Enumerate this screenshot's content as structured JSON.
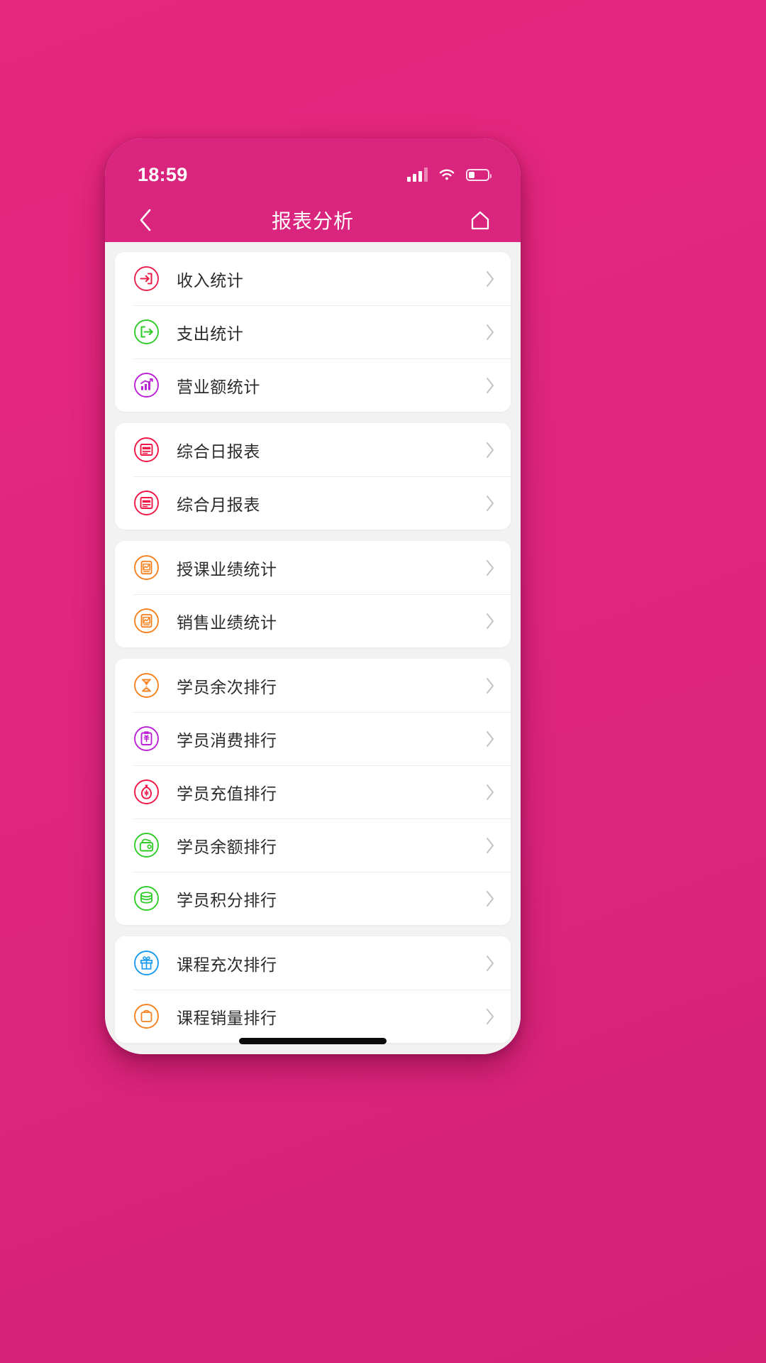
{
  "statusbar": {
    "time": "18:59",
    "signal_icon": "signal-bars-icon",
    "wifi_icon": "wifi-icon",
    "battery_icon": "battery-icon",
    "battery_level_pct": 33
  },
  "navbar": {
    "back_icon": "chevron-left-icon",
    "title": "报表分析",
    "home_icon": "home-icon"
  },
  "theme": {
    "brand_pink": "#d9257d",
    "page_background": "#e02580",
    "content_background": "#f2f2f2",
    "card_background": "#ffffff",
    "label_color": "#2b2b2b",
    "chevron_color": "#c3c3c3"
  },
  "groups": [
    {
      "items": [
        {
          "label": "收入统计",
          "icon": "income-arrow-in-icon",
          "color": "#e8214e"
        },
        {
          "label": "支出统计",
          "icon": "expense-arrow-out-icon",
          "color": "#31cc2b"
        },
        {
          "label": "营业额统计",
          "icon": "turnover-chart-icon",
          "color": "#bb22d6"
        }
      ]
    },
    {
      "items": [
        {
          "label": "综合日报表",
          "icon": "daily-report-icon",
          "color": "#f01647"
        },
        {
          "label": "综合月报表",
          "icon": "monthly-report-icon",
          "color": "#f01647"
        }
      ]
    },
    {
      "items": [
        {
          "label": "授课业绩统计",
          "icon": "teaching-performance-icon",
          "color": "#f58220"
        },
        {
          "label": "销售业绩统计",
          "icon": "sales-performance-icon",
          "color": "#f58220"
        }
      ]
    },
    {
      "items": [
        {
          "label": "学员余次排行",
          "icon": "remaining-sessions-hourglass-icon",
          "color": "#f58220"
        },
        {
          "label": "学员消费排行",
          "icon": "consumption-clipboard-icon",
          "color": "#bb22d6"
        },
        {
          "label": "学员充值排行",
          "icon": "recharge-moneybag-icon",
          "color": "#f01647"
        },
        {
          "label": "学员余额排行",
          "icon": "balance-wallet-icon",
          "color": "#31cc2b"
        },
        {
          "label": "学员积分排行",
          "icon": "points-coins-icon",
          "color": "#31cc2b"
        }
      ]
    },
    {
      "items": [
        {
          "label": "课程充次排行",
          "icon": "course-recharge-gift-icon",
          "color": "#1a9bf0"
        },
        {
          "label": "课程销量排行",
          "icon": "course-sales-icon",
          "color": "#f58220"
        }
      ]
    }
  ],
  "home_indicator": "home-indicator-bar"
}
